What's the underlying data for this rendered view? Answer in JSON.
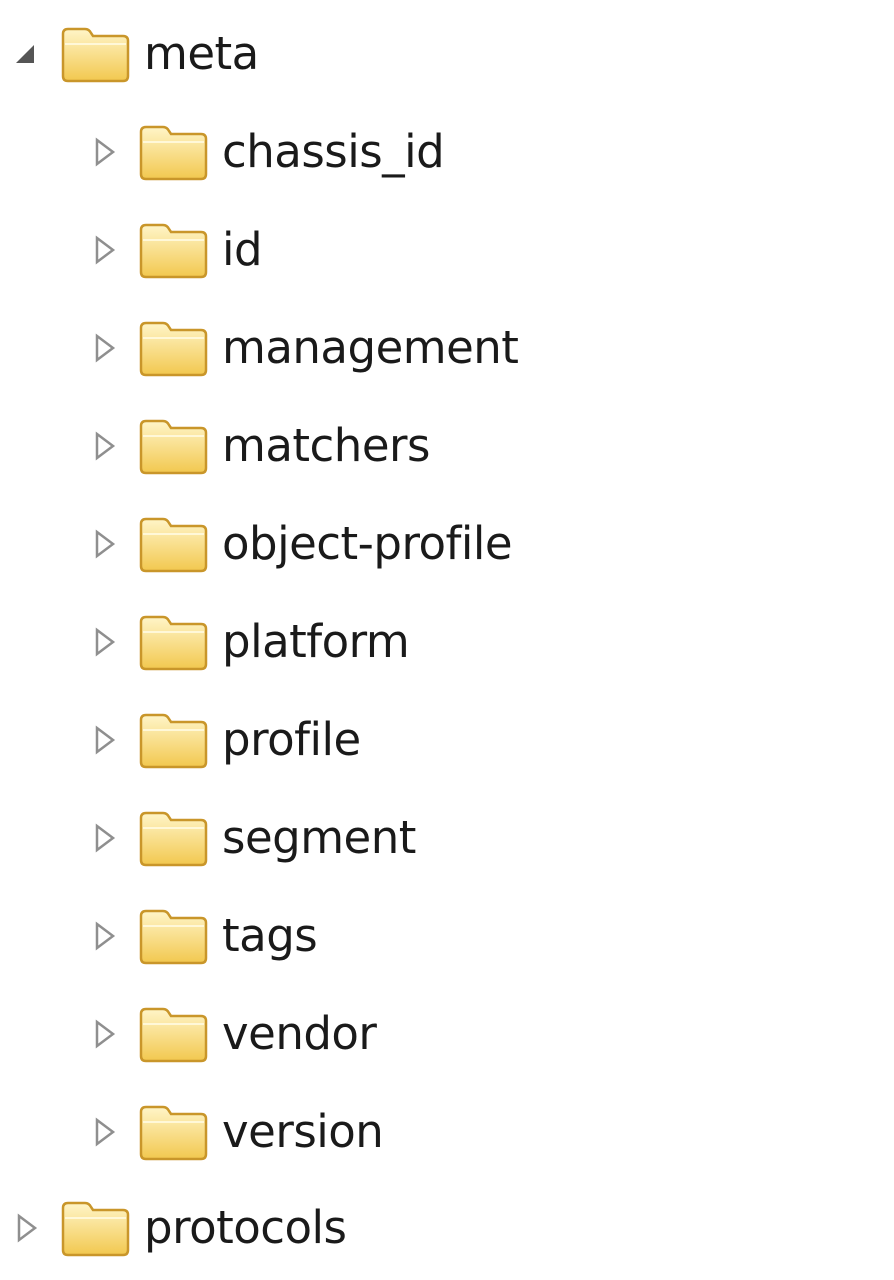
{
  "tree": {
    "root_expanded": {
      "label": "meta",
      "toggle_icon": "expanded-triangle-icon",
      "icon": "folder-icon",
      "children": [
        {
          "label": "chassis_id",
          "toggle_icon": "collapsed-triangle-icon",
          "icon": "folder-icon"
        },
        {
          "label": "id",
          "toggle_icon": "collapsed-triangle-icon",
          "icon": "folder-icon"
        },
        {
          "label": "management",
          "toggle_icon": "collapsed-triangle-icon",
          "icon": "folder-icon"
        },
        {
          "label": "matchers",
          "toggle_icon": "collapsed-triangle-icon",
          "icon": "folder-icon"
        },
        {
          "label": "object-profile",
          "toggle_icon": "collapsed-triangle-icon",
          "icon": "folder-icon"
        },
        {
          "label": "platform",
          "toggle_icon": "collapsed-triangle-icon",
          "icon": "folder-icon"
        },
        {
          "label": "profile",
          "toggle_icon": "collapsed-triangle-icon",
          "icon": "folder-icon"
        },
        {
          "label": "segment",
          "toggle_icon": "collapsed-triangle-icon",
          "icon": "folder-icon"
        },
        {
          "label": "tags",
          "toggle_icon": "collapsed-triangle-icon",
          "icon": "folder-icon"
        },
        {
          "label": "vendor",
          "toggle_icon": "collapsed-triangle-icon",
          "icon": "folder-icon"
        },
        {
          "label": "version",
          "toggle_icon": "collapsed-triangle-icon",
          "icon": "folder-icon"
        }
      ]
    },
    "root_collapsed": {
      "label": "protocols",
      "toggle_icon": "collapsed-triangle-icon",
      "icon": "folder-icon"
    }
  },
  "colors": {
    "folder_fill_top": "#fff2b8",
    "folder_fill_bottom": "#f3cc5e",
    "folder_stroke": "#c9962a",
    "toggle_collapsed": "#8f8f8f",
    "toggle_expanded": "#555555",
    "text": "#1a1a1a"
  }
}
